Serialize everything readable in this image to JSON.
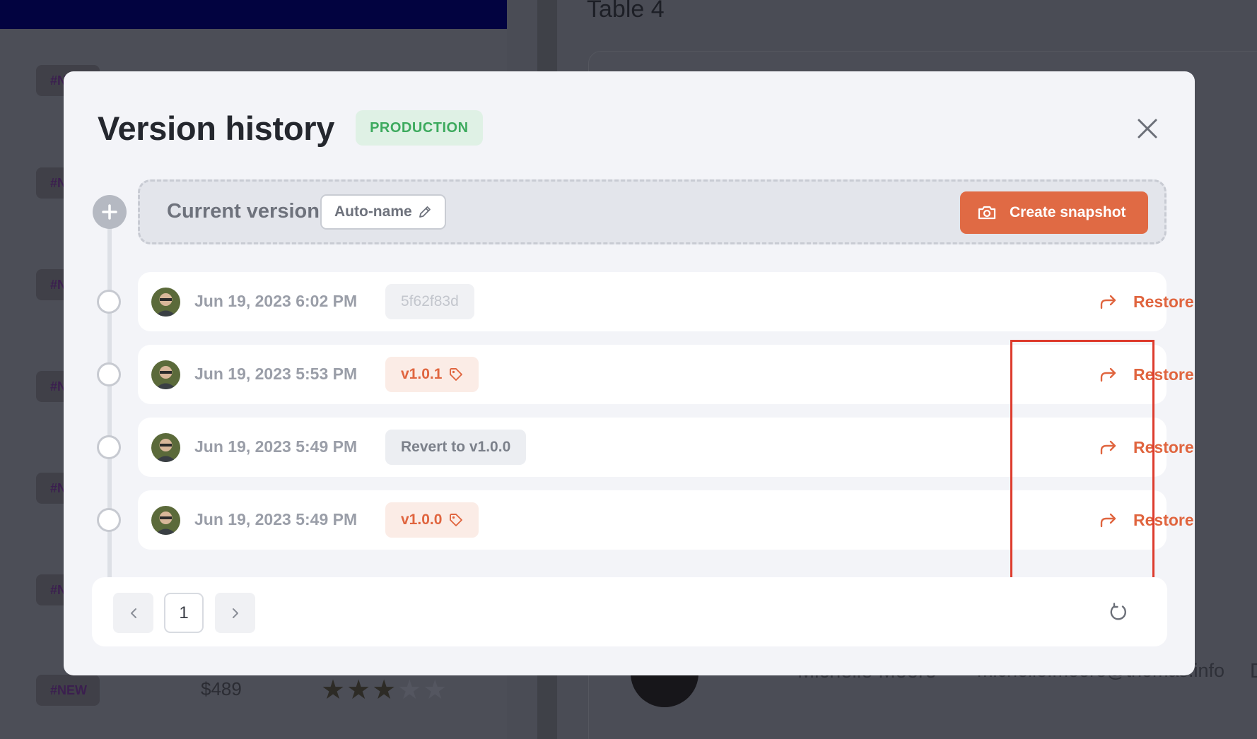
{
  "background": {
    "table_title": "Table 4",
    "tag_label": "#NEW",
    "tag_partial": "#N",
    "price": "$489",
    "row_name": "Michelle Moore",
    "row_email": "michelle.moore@thomas.info",
    "edge_letter": "D"
  },
  "modal": {
    "title": "Version history",
    "environment_badge": "PRODUCTION",
    "current_version_label": "Current version",
    "auto_name_label": "Auto-name",
    "create_snapshot_label": "Create snapshot",
    "restore_label": "Restore",
    "versions": [
      {
        "timestamp": "Jun 19, 2023 6:02 PM",
        "chip": "5f62f83d",
        "chip_type": "hash"
      },
      {
        "timestamp": "Jun 19, 2023 5:53 PM",
        "chip": "v1.0.1",
        "chip_type": "version"
      },
      {
        "timestamp": "Jun 19, 2023 5:49 PM",
        "chip": "Revert to v1.0.0",
        "chip_type": "revert"
      },
      {
        "timestamp": "Jun 19, 2023 5:49 PM",
        "chip": "v1.0.0",
        "chip_type": "version"
      }
    ],
    "pagination": {
      "current_page": "1"
    }
  },
  "colors": {
    "accent": "#e0653f",
    "badge_green": "#3daa5e",
    "highlight": "#dd3b2d"
  },
  "icons": [
    "close-icon",
    "plus-icon",
    "pencil-icon",
    "camera-icon",
    "tag-icon",
    "share-arrow-icon",
    "chevron-left-icon",
    "chevron-right-icon",
    "refresh-icon"
  ]
}
